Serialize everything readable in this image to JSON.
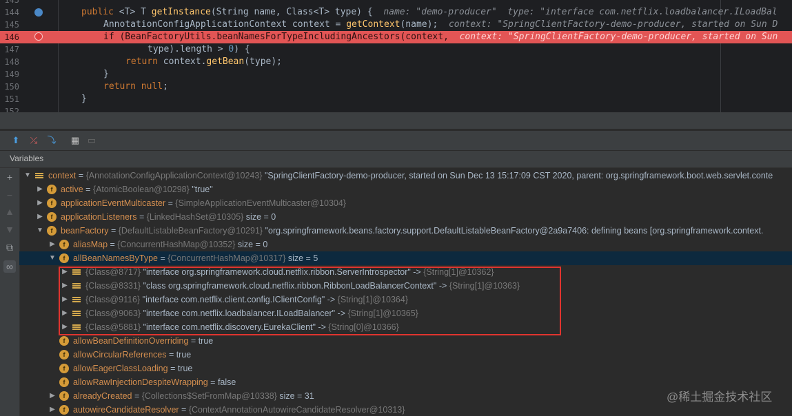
{
  "editor": {
    "lines": [
      {
        "num": "143",
        "tokens": []
      },
      {
        "num": "144",
        "tokens": [
          {
            "t": "public ",
            "c": "kw"
          },
          {
            "t": "<T> T ",
            "c": "pl"
          },
          {
            "t": "getInstance",
            "c": "fn"
          },
          {
            "t": "(String name, Class<T> type) {  ",
            "c": "pl"
          },
          {
            "t": "name: \"demo-producer\"  type: \"interface com.netflix.loadbalancer.ILoadBal",
            "c": "inl"
          }
        ]
      },
      {
        "num": "145",
        "tokens": [
          {
            "t": "AnnotationConfigApplicationContext context = ",
            "c": "pl"
          },
          {
            "t": "getContext",
            "c": "fn"
          },
          {
            "t": "(name);  ",
            "c": "pl"
          },
          {
            "t": "context: \"SpringClientFactory-demo-producer, started on Sun D",
            "c": "inl"
          }
        ]
      },
      {
        "num": "146",
        "tokens": [
          {
            "t": "if ",
            "c": "kw"
          },
          {
            "t": "(BeanFactoryUtils.beanNamesForTypeIncludingAncestors(context,  ",
            "c": "pl"
          },
          {
            "t": "context: \"SpringClientFactory-demo-producer, started on Sun",
            "c": "inl"
          }
        ]
      },
      {
        "num": "147",
        "tokens": [
          {
            "t": "type).length > ",
            "c": "pl"
          },
          {
            "t": "0",
            "c": "num"
          },
          {
            "t": ") {",
            "c": "pl"
          }
        ]
      },
      {
        "num": "148",
        "tokens": [
          {
            "t": "return ",
            "c": "kw"
          },
          {
            "t": "context.",
            "c": "pl"
          },
          {
            "t": "getBean",
            "c": "fn"
          },
          {
            "t": "(type);",
            "c": "pl"
          }
        ]
      },
      {
        "num": "149",
        "tokens": [
          {
            "t": "}",
            "c": "pl"
          }
        ]
      },
      {
        "num": "150",
        "tokens": [
          {
            "t": "return ",
            "c": "kw"
          },
          {
            "t": "null",
            "c": "kw"
          },
          {
            "t": ";",
            "c": "pl"
          }
        ]
      },
      {
        "num": "151",
        "tokens": [
          {
            "t": "}",
            "c": "pl"
          }
        ]
      },
      {
        "num": "152",
        "tokens": []
      }
    ]
  },
  "panel": {
    "title": "Variables"
  },
  "icons": {
    "toolbar": [
      "step-out-icon",
      "run-to-cursor-icon",
      "evaluate-expression-icon",
      "table-view-icon",
      "restore-layout-icon"
    ],
    "sidebar": [
      "add-watch-icon",
      "remove-watch-icon",
      "move-up-icon",
      "move-down-icon",
      "copy-icon",
      "glasses-icon"
    ]
  },
  "colors": {
    "highlight": "#e25555",
    "selection": "#0d293e",
    "redbox": "#e0342f",
    "field_icon": "#d59b38"
  },
  "tree": [
    {
      "arrow": "open",
      "icon": "list",
      "name": "context",
      "obj": "{AnnotationConfigApplicationContext@10243}",
      "val": " \"SpringClientFactory-demo-producer, started on Sun Dec 13 15:17:09 CST 2020, parent: org.springframework.boot.web.servlet.conte"
    },
    {
      "arrow": "closed",
      "icon": "field",
      "name": "active",
      "obj": "{AtomicBoolean@10298}",
      "val": " \"true\""
    },
    {
      "arrow": "closed",
      "icon": "field",
      "name": "applicationEventMulticaster",
      "obj": "{SimpleApplicationEventMulticaster@10304}",
      "val": ""
    },
    {
      "arrow": "closed",
      "icon": "field",
      "name": "applicationListeners",
      "obj": "{LinkedHashSet@10305}",
      "val": "  size = 0"
    },
    {
      "arrow": "open",
      "icon": "field",
      "name": "beanFactory",
      "obj": "{DefaultListableBeanFactory@10291}",
      "val": " \"org.springframework.beans.factory.support.DefaultListableBeanFactory@2a9a7406: defining beans [org.springframework.context."
    },
    {
      "arrow": "closed",
      "icon": "field",
      "name": "aliasMap",
      "obj": "{ConcurrentHashMap@10352}",
      "val": "  size = 0"
    },
    {
      "arrow": "open",
      "icon": "field",
      "name": "allBeanNamesByType",
      "obj": "{ConcurrentHashMap@10317}",
      "val": "  size = 5",
      "selected": true
    },
    {
      "arrow": "closed",
      "icon": "list",
      "name": "",
      "obj": "{Class@8717}",
      "val": " \"interface org.springframework.cloud.netflix.ribbon.ServerIntrospector\"",
      "tail": "-> ",
      "tailobj": "{String[1]@10362}"
    },
    {
      "arrow": "closed",
      "icon": "list",
      "name": "",
      "obj": "{Class@8331}",
      "val": " \"class org.springframework.cloud.netflix.ribbon.RibbonLoadBalancerContext\"",
      "tail": "-> ",
      "tailobj": "{String[1]@10363}"
    },
    {
      "arrow": "closed",
      "icon": "list",
      "name": "",
      "obj": "{Class@9116}",
      "val": " \"interface com.netflix.client.config.IClientConfig\"",
      "tail": "-> ",
      "tailobj": "{String[1]@10364}"
    },
    {
      "arrow": "closed",
      "icon": "list",
      "name": "",
      "obj": "{Class@9063}",
      "val": " \"interface com.netflix.loadbalancer.ILoadBalancer\"",
      "tail": "-> ",
      "tailobj": "{String[1]@10365}"
    },
    {
      "arrow": "closed",
      "icon": "list",
      "name": "",
      "obj": "{Class@5881}",
      "val": " \"interface com.netflix.discovery.EurekaClient\"",
      "tail": "-> ",
      "tailobj": "{String[0]@10366}"
    },
    {
      "arrow": "none",
      "icon": "field",
      "name": "allowBeanDefinitionOverriding",
      "obj": "",
      "val": " = true"
    },
    {
      "arrow": "none",
      "icon": "field",
      "name": "allowCircularReferences",
      "obj": "",
      "val": " = true"
    },
    {
      "arrow": "none",
      "icon": "field",
      "name": "allowEagerClassLoading",
      "obj": "",
      "val": " = true"
    },
    {
      "arrow": "none",
      "icon": "field",
      "name": "allowRawInjectionDespiteWrapping",
      "obj": "",
      "val": " = false"
    },
    {
      "arrow": "closed",
      "icon": "field",
      "name": "alreadyCreated",
      "obj": "{Collections$SetFromMap@10338}",
      "val": "  size = 31"
    },
    {
      "arrow": "closed",
      "icon": "field",
      "name": "autowireCandidateResolver",
      "obj": "{ContextAnnotationAutowireCandidateResolver@10313}",
      "val": ""
    }
  ],
  "watermark": "@稀土掘金技术社区"
}
